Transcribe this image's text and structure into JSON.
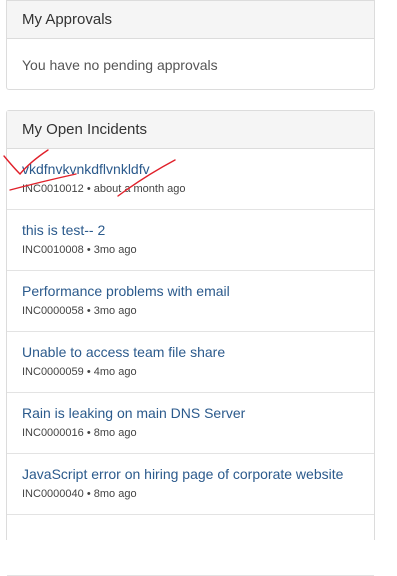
{
  "approvals": {
    "heading": "My Approvals",
    "empty_text": "You have no pending approvals"
  },
  "incidents": {
    "heading": "My Open Incidents",
    "items": [
      {
        "title": "vkdfnvkvnkdflvnkldfv",
        "number": "INC0010012",
        "age": "about a month ago"
      },
      {
        "title": "this is test-- 2",
        "number": "INC0010008",
        "age": "3mo ago"
      },
      {
        "title": "Performance problems with email",
        "number": "INC0000058",
        "age": "3mo ago"
      },
      {
        "title": "Unable to access team file share",
        "number": "INC0000059",
        "age": "4mo ago"
      },
      {
        "title": "Rain is leaking on main DNS Server",
        "number": "INC0000016",
        "age": "8mo ago"
      },
      {
        "title": "JavaScript error on hiring page of corporate website",
        "number": "INC0000040",
        "age": "8mo ago"
      }
    ]
  },
  "annotation_color": "#e0202a"
}
